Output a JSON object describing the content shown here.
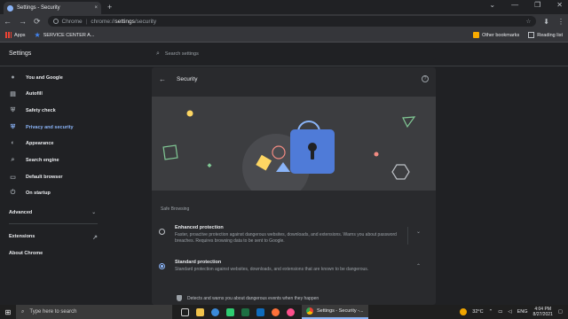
{
  "browser": {
    "tab_title": "Settings - Security",
    "tab_close": "×",
    "new_tab": "+",
    "window_controls": [
      "⌄",
      "—",
      "❐",
      "✕"
    ],
    "nav_icons": [
      "←",
      "→",
      "⟳"
    ],
    "url_prefix": "Chrome",
    "url_scheme": "chrome://",
    "url_host": "settings",
    "url_path": "/security",
    "toolbar_icons": [
      "☆",
      "⬇",
      "⋮"
    ]
  },
  "bookmarks": {
    "items": [
      {
        "label": "Apps",
        "icon": "apps-grid-icon",
        "color": "#ea4335"
      },
      {
        "label": "SERVICE CENTER A...",
        "icon": "star-icon",
        "color": "#4285f4"
      }
    ],
    "other": "Other bookmarks",
    "reading_list": "Reading list"
  },
  "settings": {
    "title": "Settings",
    "search_placeholder": "Search settings"
  },
  "sidebar": {
    "items": [
      {
        "label": "You and Google",
        "icon": "person-icon",
        "glyph": "👤"
      },
      {
        "label": "Autofill",
        "icon": "clipboard-icon",
        "glyph": "▤"
      },
      {
        "label": "Safety check",
        "icon": "shield-check-icon",
        "glyph": "⛨"
      },
      {
        "label": "Privacy and security",
        "icon": "shield-icon",
        "glyph": "⛨"
      },
      {
        "label": "Appearance",
        "icon": "palette-icon",
        "glyph": "◐"
      },
      {
        "label": "Search engine",
        "icon": "search-icon",
        "glyph": "⌕"
      },
      {
        "label": "Default browser",
        "icon": "browser-icon",
        "glyph": "▭"
      },
      {
        "label": "On startup",
        "icon": "power-icon",
        "glyph": "⏻"
      }
    ],
    "active_index": 3,
    "advanced": "Advanced",
    "advanced_chevron": "⌄",
    "extensions": "Extensions",
    "extensions_icon": "↗",
    "about": "About Chrome"
  },
  "security": {
    "back": "←",
    "title": "Security",
    "help": "?",
    "section_label": "Safe Browsing",
    "options": [
      {
        "title": "Enhanced protection",
        "desc": "Faster, proactive protection against dangerous websites, downloads, and extensions. Warns you about password breaches. Requires browsing data to be sent to Google.",
        "selected": false,
        "chevron": "⌄"
      },
      {
        "title": "Standard protection",
        "desc": "Standard protection against websites, downloads, and extensions that are known to be dangerous.",
        "selected": true,
        "chevron": "⌃"
      }
    ],
    "detail": "Detects and warns you about dangerous events when they happen"
  },
  "taskbar": {
    "search_placeholder": "Type here to search",
    "chrome_task": "Settings - Security -...",
    "temperature": "32°C",
    "language": "ENG",
    "time": "4:04 PM",
    "date": "8/27/2021",
    "app_colors": [
      "#cfcfcf",
      "#f0c24b",
      "#3b8ad9",
      "#2ecc71",
      "#1d6f42",
      "#0f6cbd",
      "#ff7139",
      "#ff4f8b"
    ]
  },
  "colors": {
    "accent": "#8ab4f8",
    "lock": "#4f7bd8",
    "background": "#202124",
    "card": "#292a2d"
  }
}
